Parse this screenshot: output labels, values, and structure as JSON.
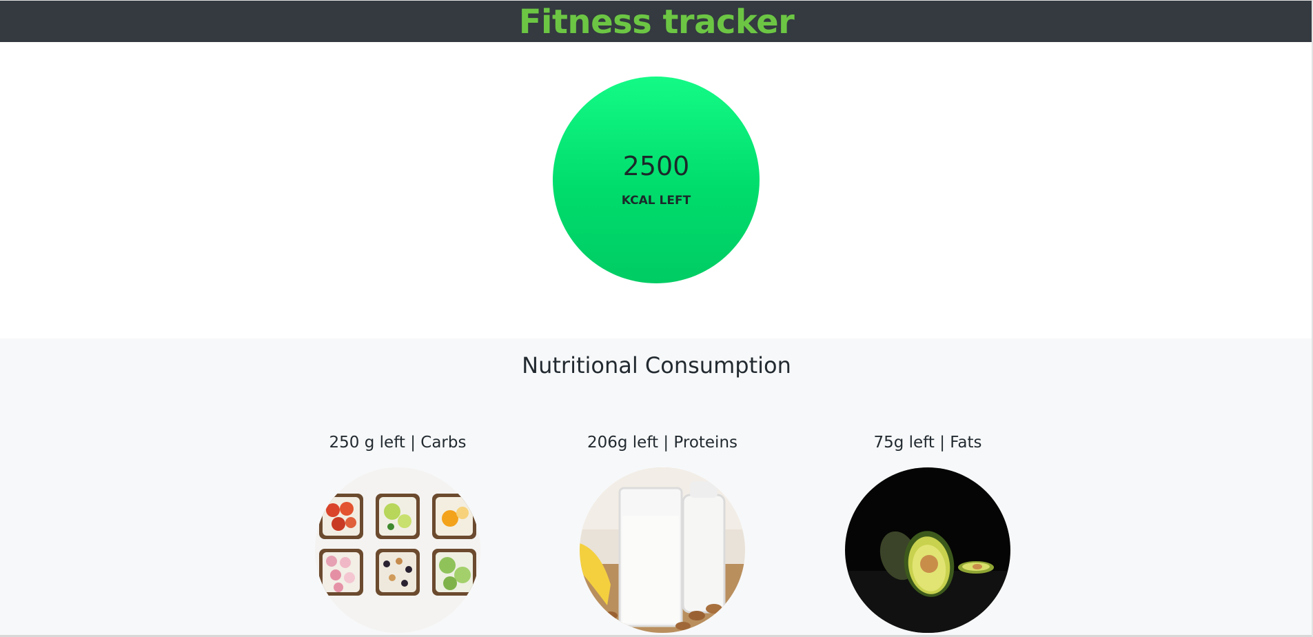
{
  "header": {
    "title": "Fitness tracker",
    "title_color": "#6cc644",
    "background": "#343a40"
  },
  "calories": {
    "value": "2500",
    "label": "KCAL LEFT",
    "circle_color": "#00dc6c"
  },
  "nutrition": {
    "title": "Nutritional Consumption",
    "macros": [
      {
        "label": "250 g left | Carbs",
        "image": "toast-with-toppings-photo"
      },
      {
        "label": "206g left | Proteins",
        "image": "milk-glasses-almonds-photo"
      },
      {
        "label": "75g left | Fats",
        "image": "avocado-on-black-photo"
      }
    ]
  }
}
